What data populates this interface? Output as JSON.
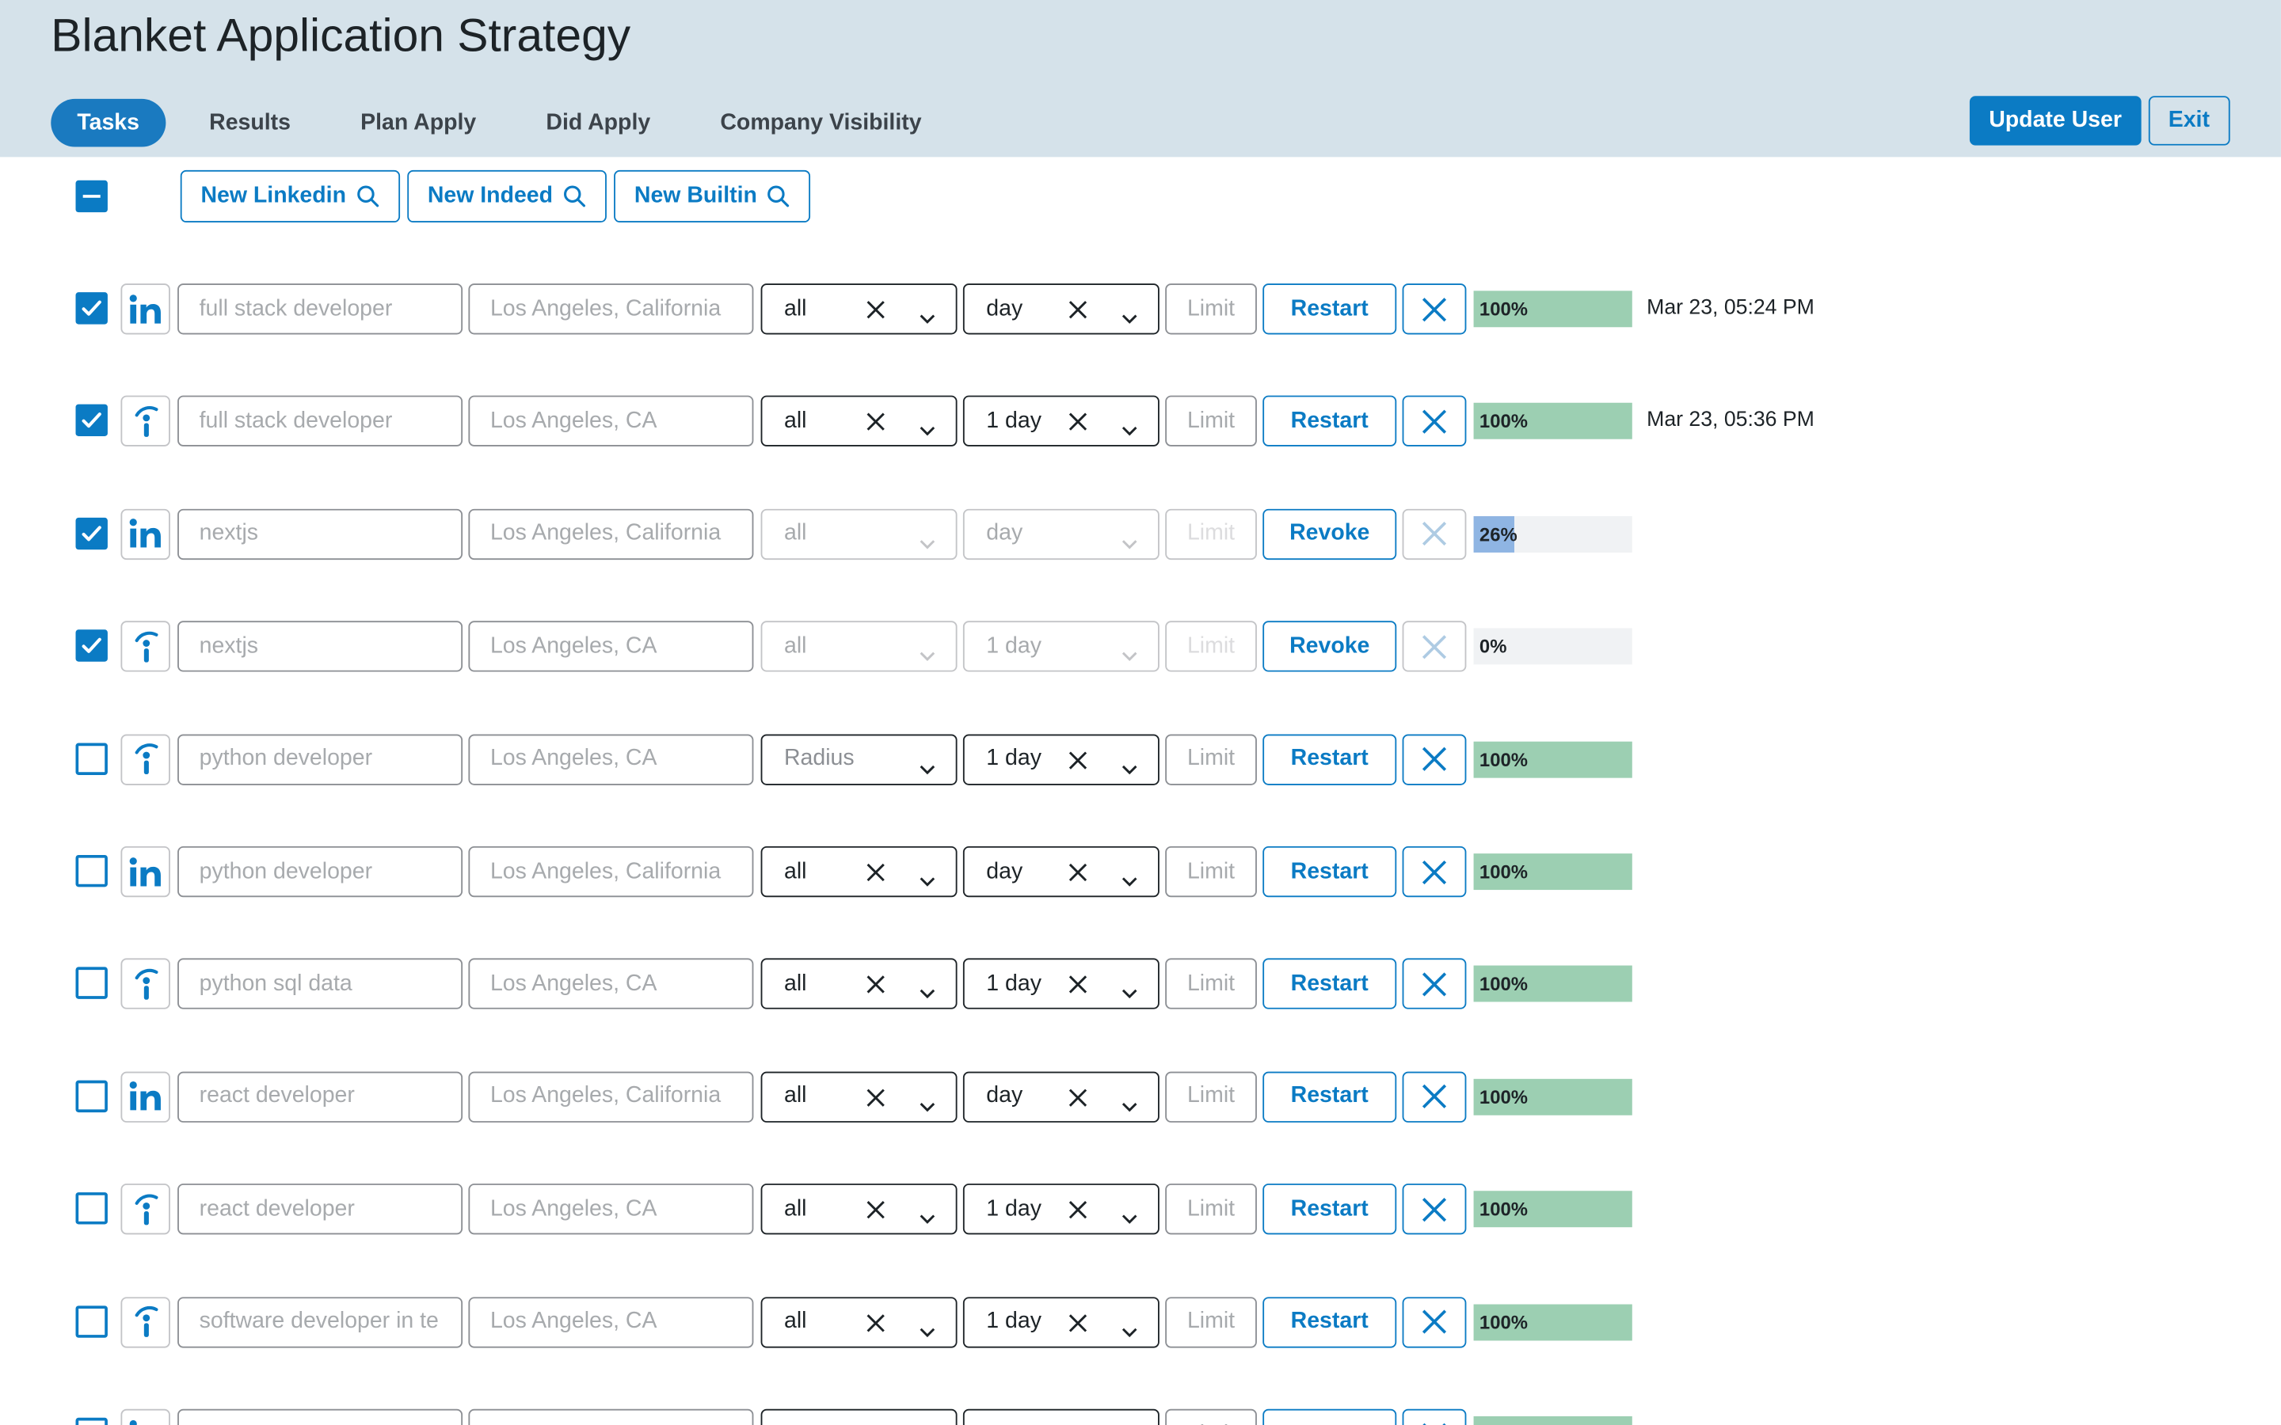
{
  "app": {
    "title": "Blanket Application Strategy"
  },
  "tabs": [
    {
      "label": "Tasks",
      "active": true
    },
    {
      "label": "Results"
    },
    {
      "label": "Plan Apply"
    },
    {
      "label": "Did Apply"
    },
    {
      "label": "Company Visibility"
    }
  ],
  "header_buttons": {
    "update_user": "Update User",
    "exit": "Exit"
  },
  "toolbar": {
    "new_buttons": [
      {
        "label": "New Linkedin",
        "icon": "search-icon"
      },
      {
        "label": "New Indeed",
        "icon": "search-icon"
      },
      {
        "label": "New Builtin",
        "icon": "search-icon"
      }
    ]
  },
  "colors": {
    "accent": "#0b7bc4",
    "header_bg": "#d5e2ea",
    "progress_done": "#9ccfb2",
    "progress_active": "#8fb5e3"
  },
  "limit_placeholder": "Limit",
  "tasks": [
    {
      "checked": true,
      "source": "linkedin-icon",
      "title": "full stack developer",
      "location": "Los Angeles, California",
      "distance": "all",
      "date": "day",
      "action": "Restart",
      "enabled": true,
      "progress": 100,
      "progress_label": "100%",
      "when": "Mar 23, 05:24 PM"
    },
    {
      "checked": true,
      "source": "indeed-icon",
      "title": "full stack developer",
      "location": "Los Angeles, CA",
      "distance": "all",
      "date": "1 day",
      "action": "Restart",
      "enabled": true,
      "progress": 100,
      "progress_label": "100%",
      "when": "Mar 23, 05:36 PM"
    },
    {
      "checked": true,
      "source": "linkedin-icon",
      "title": "nextjs",
      "location": "Los Angeles, California",
      "distance": "all",
      "date": "day",
      "action": "Revoke",
      "enabled": false,
      "progress": 26,
      "progress_label": "26%",
      "when": ""
    },
    {
      "checked": true,
      "source": "indeed-icon",
      "title": "nextjs",
      "location": "Los Angeles, CA",
      "distance": "all",
      "date": "1 day",
      "action": "Revoke",
      "enabled": false,
      "progress": 0,
      "progress_label": "0%",
      "when": ""
    },
    {
      "checked": false,
      "source": "indeed-icon",
      "title": "python developer",
      "location": "Los Angeles, CA",
      "distance": "Radius",
      "distance_placeholder": true,
      "date": "1 day",
      "action": "Restart",
      "enabled": true,
      "progress": 100,
      "progress_label": "100%",
      "when": ""
    },
    {
      "checked": false,
      "source": "linkedin-icon",
      "title": "python developer",
      "location": "Los Angeles, California",
      "distance": "all",
      "date": "day",
      "action": "Restart",
      "enabled": true,
      "progress": 100,
      "progress_label": "100%",
      "when": ""
    },
    {
      "checked": false,
      "source": "indeed-icon",
      "title": "python sql data",
      "location": "Los Angeles, CA",
      "distance": "all",
      "date": "1 day",
      "action": "Restart",
      "enabled": true,
      "progress": 100,
      "progress_label": "100%",
      "when": ""
    },
    {
      "checked": false,
      "source": "linkedin-icon",
      "title": "react developer",
      "location": "Los Angeles, California",
      "distance": "all",
      "date": "day",
      "action": "Restart",
      "enabled": true,
      "progress": 100,
      "progress_label": "100%",
      "when": ""
    },
    {
      "checked": false,
      "source": "indeed-icon",
      "title": "react developer",
      "location": "Los Angeles, CA",
      "distance": "all",
      "date": "1 day",
      "action": "Restart",
      "enabled": true,
      "progress": 100,
      "progress_label": "100%",
      "when": ""
    },
    {
      "checked": false,
      "source": "indeed-icon",
      "title": "software developer in te",
      "location": "Los Angeles, CA",
      "distance": "all",
      "date": "1 day",
      "action": "Restart",
      "enabled": true,
      "progress": 100,
      "progress_label": "100%",
      "when": ""
    },
    {
      "checked": false,
      "source": "linkedin-icon",
      "title": "",
      "location": "",
      "distance": "",
      "date": "",
      "action": "",
      "enabled": true,
      "progress": 100,
      "progress_label": "",
      "when": ""
    }
  ]
}
